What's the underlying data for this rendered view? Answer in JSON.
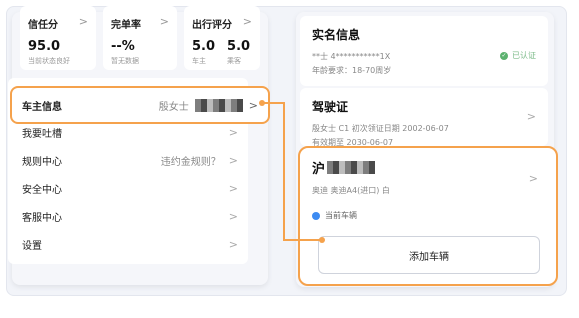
{
  "stats": [
    {
      "title": "信任分",
      "value": "95.0",
      "sub": "当前状态良好"
    },
    {
      "title": "完单率",
      "value": "--%",
      "sub": "暂无数据"
    },
    {
      "title": "出行评分",
      "pairs": [
        {
          "value": "5.0",
          "sub": "车主"
        },
        {
          "value": "5.0",
          "sub": "乘客"
        }
      ]
    }
  ],
  "owner_row": {
    "label": "车主信息",
    "value": "殷女士"
  },
  "menu": [
    {
      "label": "我要吐槽",
      "extra": ""
    },
    {
      "label": "规则中心",
      "extra": "违约金规则？"
    },
    {
      "label": "安全中心",
      "extra": ""
    },
    {
      "label": "客服中心",
      "extra": ""
    },
    {
      "label": "设置",
      "extra": ""
    }
  ],
  "identity": {
    "title": "实名信息",
    "id_line": "**士 4***********1X",
    "age_line": "年龄要求：18-70周岁",
    "status": "已认证"
  },
  "license": {
    "title": "驾驶证",
    "line1": "殷女士 C1 初次领证日期 2002-06-07",
    "line2": "有效期至 2030-06-07"
  },
  "vehicle": {
    "plate_prefix": "沪",
    "model": "奥迪 奥迪A4(进口) 白",
    "current_label": "当前车辆",
    "add_button": "添加车辆"
  },
  "colors": {
    "highlight": "#f5a24c",
    "verified": "#5cb26f",
    "current_dot": "#3d8bf2"
  }
}
